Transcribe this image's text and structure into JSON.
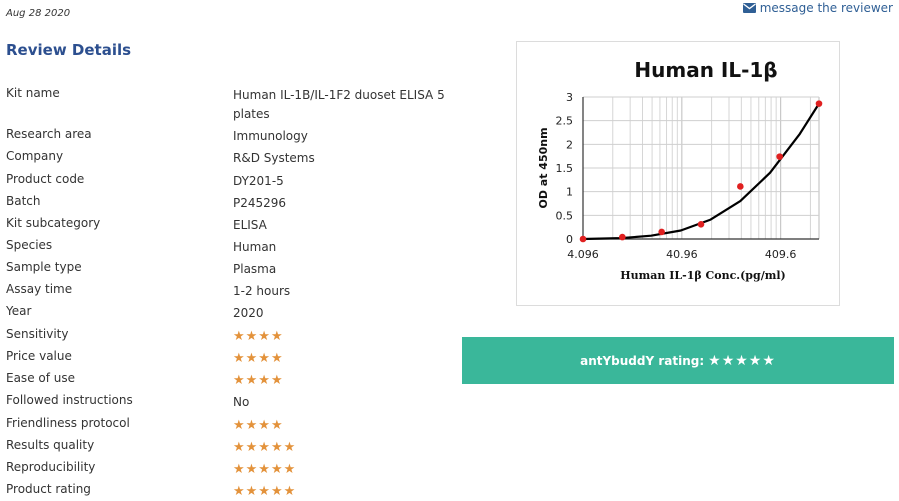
{
  "header": {
    "date": "Aug 28 2020",
    "message_link": "message the reviewer"
  },
  "section_title": "Review Details",
  "details": [
    {
      "label": "Kit name",
      "value": "Human IL-1B/IL-1F2 duoset ELISA 5 plates"
    },
    {
      "label": "Research area",
      "value": "Immunology"
    },
    {
      "label": "Company",
      "value": "R&D Systems"
    },
    {
      "label": "Product code",
      "value": "DY201-5"
    },
    {
      "label": "Batch",
      "value": "P245296"
    },
    {
      "label": "Kit subcategory",
      "value": "ELISA"
    },
    {
      "label": "Species",
      "value": "Human"
    },
    {
      "label": "Sample type",
      "value": "Plasma"
    },
    {
      "label": "Assay time",
      "value": "1-2 hours"
    },
    {
      "label": "Year",
      "value": "2020"
    },
    {
      "label": "Sensitivity",
      "stars": 4
    },
    {
      "label": "Price value",
      "stars": 4
    },
    {
      "label": "Ease of use",
      "stars": 4
    },
    {
      "label": "Followed instructions",
      "value": "No"
    },
    {
      "label": "Friendliness protocol",
      "stars": 4
    },
    {
      "label": "Results quality",
      "stars": 5
    },
    {
      "label": "Reproducibility",
      "stars": 5
    },
    {
      "label": "Product rating",
      "stars": 5
    }
  ],
  "rating": {
    "label": "antYbuddY rating:",
    "stars": 5
  },
  "colors": {
    "accent": "#3ab79a",
    "title": "#2c4f8f",
    "star": "#e3923b",
    "point": "#e02020"
  },
  "chart_data": {
    "type": "scatter",
    "title": "Human IL-1β",
    "xlabel": "Human  IL-1β Conc.(pg/ml)",
    "ylabel": "OD at 450nm",
    "x_scale": "log",
    "xlim": [
      4.096,
      1000
    ],
    "ylim": [
      0,
      3
    ],
    "x_ticks": [
      "4.096",
      "40.96",
      "409.6"
    ],
    "y_ticks": [
      "0",
      "0.5",
      "1",
      "1.5",
      "2",
      "2.5",
      "3"
    ],
    "grid": true,
    "series": [
      {
        "type": "scatter",
        "x": [
          4.096,
          10.24,
          25.6,
          64,
          160,
          400,
          1000
        ],
        "y": [
          0.0,
          0.04,
          0.15,
          0.31,
          1.11,
          1.74,
          2.86
        ]
      },
      {
        "type": "line",
        "x": [
          4.096,
          10,
          20,
          40,
          80,
          160,
          320,
          640,
          1000
        ],
        "y": [
          0.0,
          0.02,
          0.07,
          0.18,
          0.41,
          0.8,
          1.4,
          2.22,
          2.86
        ]
      }
    ]
  }
}
